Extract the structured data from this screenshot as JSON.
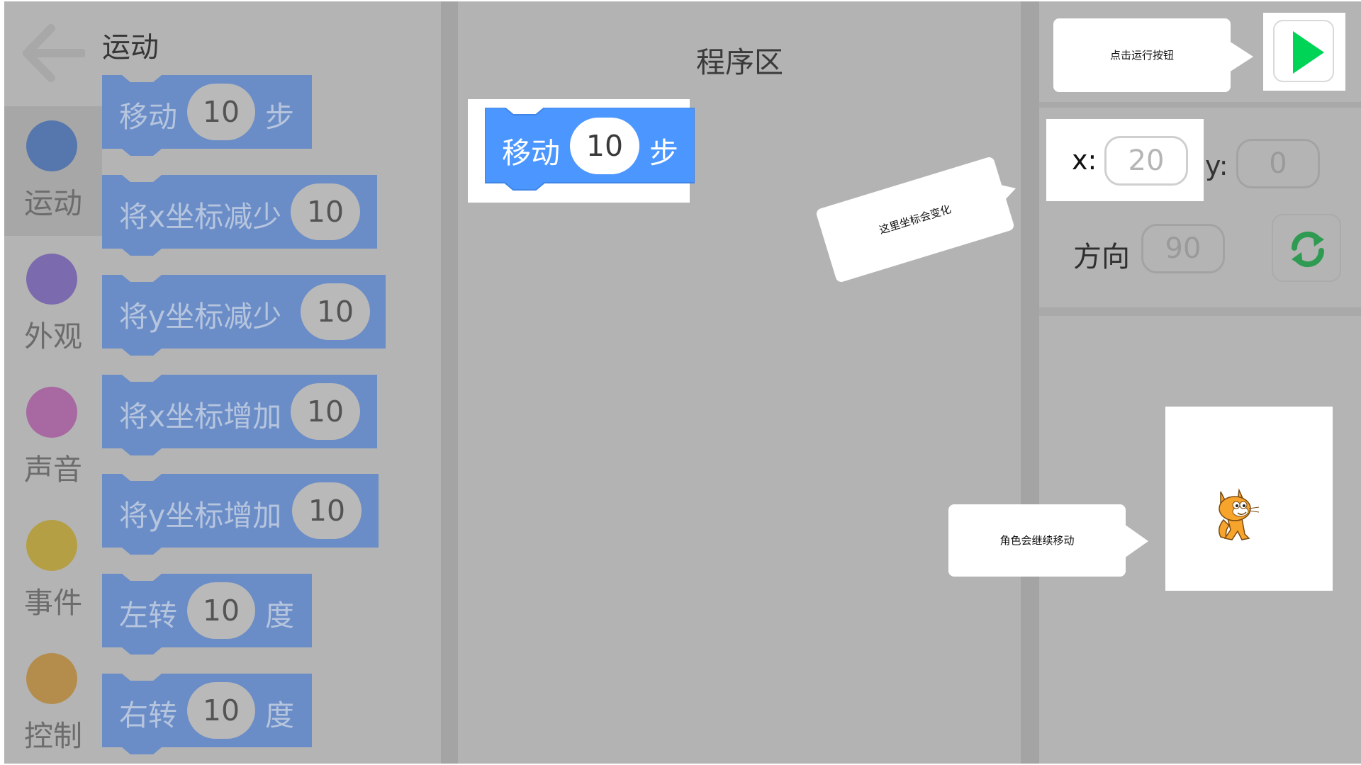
{
  "categories": [
    {
      "label": "运动",
      "color": "#5677ad",
      "active": true
    },
    {
      "label": "外观",
      "color": "#7b6aad"
    },
    {
      "label": "声音",
      "color": "#a868a2"
    },
    {
      "label": "事件",
      "color": "#b59f45"
    },
    {
      "label": "控制",
      "color": "#b48d4d"
    }
  ],
  "palette": {
    "title": "运动",
    "blocks": [
      {
        "pre": "移动",
        "value": "10",
        "post": "步"
      },
      {
        "pre": "将x坐标减少",
        "value": "10",
        "post": ""
      },
      {
        "pre": "将y坐标减少",
        "value": "10",
        "post": ""
      },
      {
        "pre": "将x坐标增加",
        "value": "10",
        "post": ""
      },
      {
        "pre": "将y坐标增加",
        "value": "10",
        "post": ""
      },
      {
        "pre": "左转",
        "value": "10",
        "post": "度"
      },
      {
        "pre": "右转",
        "value": "10",
        "post": "度"
      }
    ]
  },
  "program": {
    "title": "程序区",
    "block": {
      "pre": "移动",
      "value": "10",
      "post": "步"
    }
  },
  "sprite_info": {
    "x_label": "x:",
    "x_value": "20",
    "y_label": "y:",
    "y_value": "0",
    "direction_label": "方向",
    "direction_value": "90"
  },
  "callouts": {
    "run": "点击运行按钮",
    "coord": "这里坐标会变化",
    "sprite": "角色会继续移动"
  },
  "colors": {
    "block_blue": "#4c97ff",
    "block_dimmed": "#6a8cc7",
    "run_green": "#00d457",
    "reset_green": "#2f9b52"
  }
}
